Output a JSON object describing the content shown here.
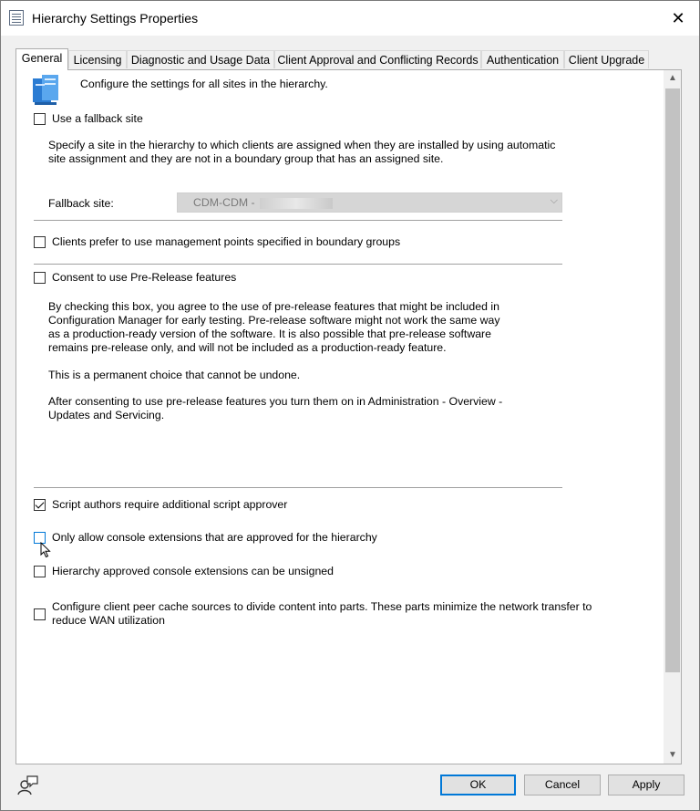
{
  "window": {
    "title": "Hierarchy Settings Properties",
    "close": "✕"
  },
  "tabs": [
    {
      "label": "General"
    },
    {
      "label": "Licensing"
    },
    {
      "label": "Diagnostic and Usage Data"
    },
    {
      "label": "Client Approval and Conflicting Records"
    },
    {
      "label": "Authentication"
    },
    {
      "label": "Client Upgrade"
    }
  ],
  "general": {
    "intro": "Configure the settings for all sites in the hierarchy.",
    "fallback_checkbox": {
      "label": "Use a fallback site",
      "checked": false
    },
    "fallback_desc": "Specify a site in the hierarchy to which clients are assigned when they are installed by using automatic site assignment and they are not in a boundary group that has an assigned site.",
    "fallback_site_label": "Fallback site:",
    "fallback_site_value": "CDM-CDM - ",
    "boundary_checkbox": {
      "label": "Clients prefer to use management points specified in boundary groups",
      "checked": false
    },
    "prerelease_checkbox": {
      "label": "Consent to use Pre-Release features",
      "checked": false
    },
    "prerelease_desc1": "By checking this box, you agree to the use of pre-release features that might be included in Configuration Manager for early testing. Pre-release software might not work the same way as a production-ready version of the software. It is also possible that pre-release software remains pre-release only, and will not be included as a production-ready feature.",
    "prerelease_desc2": "This is a permanent choice that cannot be undone.",
    "prerelease_desc3": "After consenting to use pre-release features you turn them on in Administration - Overview - Updates and Servicing.",
    "script_checkbox": {
      "label": "Script authors require additional script approver",
      "checked": true
    },
    "console_ext_checkbox": {
      "label": "Only allow console extensions that are approved for the hierarchy",
      "checked": false
    },
    "unsigned_checkbox": {
      "label": "Hierarchy approved console extensions can be unsigned",
      "checked": false
    },
    "peer_cache_checkbox": {
      "label": "Configure client peer cache sources to divide content into parts. These parts minimize the network transfer to reduce WAN utilization",
      "checked": false
    }
  },
  "buttons": {
    "ok": "OK",
    "cancel": "Cancel",
    "apply": "Apply"
  },
  "scroll": {
    "up": "▲",
    "down": "▼"
  },
  "icons": {
    "app": "properties-sheet-icon",
    "hero": "hierarchy-servers-icon",
    "help": "help-user-icon"
  },
  "colors": {
    "accent": "#0078d7",
    "panel": "#ffffff",
    "chrome": "#f0f0f0"
  }
}
